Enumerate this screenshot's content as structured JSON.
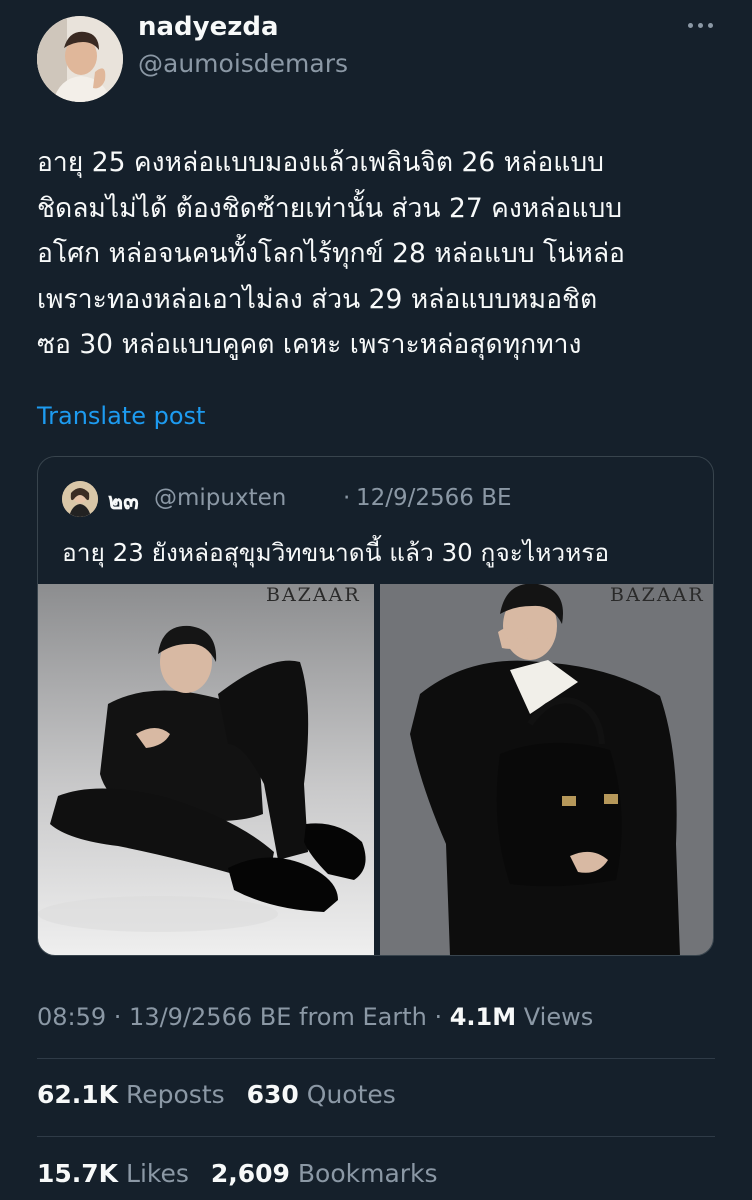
{
  "author": {
    "display_name": "nadyezda",
    "handle": "@aumoisdemars"
  },
  "menu_icon": "more-horizontal-icon",
  "tweet": {
    "lines": [
      "อายุ 25 คงหล่อแบบมองแล้วเพลินจิต 26 หล่อแบบ",
      "ชิดลมไม่ได้ ต้องชิดซ้ายเท่านั้น ส่วน 27 คงหล่อแบบ",
      "อโศก หล่อจนคนทั้งโลกไร้ทุกข์ 28 หล่อแบบ โน่หล่อ",
      "เพราะทองหล่อเอาไม่ลง ส่วน 29 หล่อแบบหมอชิต",
      "ซอ 30 หล่อแบบคูคต เคหะ เพราะหล่อสุดทุกทาง"
    ],
    "translate_label": "Translate post"
  },
  "quoted": {
    "name": "๒๓",
    "handle": "@mipuxten",
    "separator": "·",
    "date": "12/9/2566 BE",
    "text": "อายุ 23 ยังหล่อสุขุมวิทขนาดนี้ แล้ว 30 กูจะไหวหรอ",
    "magazine_mark_1": "BAZAAR",
    "magazine_mark_2": "BAZAAR"
  },
  "meta": {
    "time_date": "08:59 · 13/9/2566 BE from Earth ·",
    "views_count": "4.1M",
    "views_label": "Views"
  },
  "stats": {
    "reposts_count": "62.1K",
    "reposts_label": "Reposts",
    "quotes_count": "630",
    "quotes_label": "Quotes",
    "likes_count": "15.7K",
    "likes_label": "Likes",
    "bookmarks_count": "2,609",
    "bookmarks_label": "Bookmarks"
  },
  "colors": {
    "background": "#15202b",
    "text": "#f7f9f9",
    "secondary": "#8b98a5",
    "link": "#1d9bf0",
    "border": "#38444d"
  }
}
